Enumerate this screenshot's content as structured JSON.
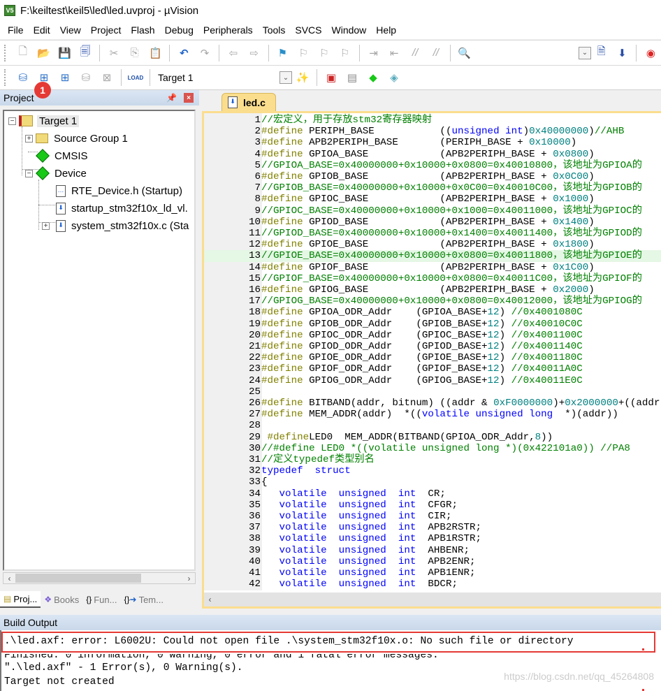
{
  "window": {
    "title": "F:\\keiltest\\keil5\\led\\led.uvproj - µVision",
    "app_icon_text": "V5"
  },
  "menu": [
    "File",
    "Edit",
    "View",
    "Project",
    "Flash",
    "Debug",
    "Peripherals",
    "Tools",
    "SVCS",
    "Window",
    "Help"
  ],
  "toolbar": {
    "target_select": "Target 1",
    "badge": "1",
    "load_label": "LOAD"
  },
  "project_panel": {
    "title": "Project",
    "tree": [
      {
        "label": "Target 1",
        "level": 0,
        "icon": "target-icon",
        "expanded": true
      },
      {
        "label": "Source Group 1",
        "level": 1,
        "icon": "folder-icon",
        "expanded": false
      },
      {
        "label": "CMSIS",
        "level": 1,
        "icon": "component-diamond-icon"
      },
      {
        "label": "Device",
        "level": 1,
        "icon": "component-diamond-icon",
        "expanded": true
      },
      {
        "label": "RTE_Device.h (Startup)",
        "level": 2,
        "icon": "header-file-icon"
      },
      {
        "label": "startup_stm32f10x_ld_vl.",
        "level": 2,
        "icon": "source-file-icon"
      },
      {
        "label": "system_stm32f10x.c (Sta",
        "level": 2,
        "icon": "source-file-icon",
        "expanded": false
      }
    ],
    "tabs": [
      {
        "label": "Proj...",
        "icon": "project-icon",
        "active": true
      },
      {
        "label": "Books",
        "icon": "books-icon",
        "active": false
      },
      {
        "label": "Fun...",
        "icon": "braces-icon",
        "active": false
      },
      {
        "label": "Tem...",
        "icon": "template-icon",
        "active": false
      }
    ]
  },
  "editor": {
    "tab": "led.c",
    "highlighted_line": 13,
    "lines": [
      [
        [
          "cm",
          "//宏定义，用于存放stm32寄存器映射"
        ]
      ],
      [
        [
          "pp",
          "#define"
        ],
        [
          "",
          "PERIPH_BASE           (("
        ],
        [
          "kw",
          "unsigned int"
        ],
        [
          "",
          ")"
        ],
        [
          "nm",
          "0x40000000"
        ],
        [
          "",
          ")"
        ],
        [
          "cm",
          "//AHB"
        ]
      ],
      [
        [
          "pp",
          "#define"
        ],
        [
          "",
          "APB2PERIPH_BASE       (PERIPH_BASE + "
        ],
        [
          "nm",
          "0x10000"
        ],
        [
          "",
          ")"
        ]
      ],
      [
        [
          "pp",
          "#define"
        ],
        [
          "",
          "GPIOA_BASE            (APB2PERIPH_BASE + "
        ],
        [
          "nm",
          "0x0800"
        ],
        [
          "",
          ")"
        ]
      ],
      [
        [
          "cm",
          "//GPIOA_BASE=0x40000000+0x10000+0x0800=0x40010800，该地址为GPIOA的"
        ]
      ],
      [
        [
          "pp",
          "#define"
        ],
        [
          "",
          "GPIOB_BASE            (APB2PERIPH_BASE + "
        ],
        [
          "nm",
          "0x0C00"
        ],
        [
          "",
          ")"
        ]
      ],
      [
        [
          "cm",
          "//GPIOB_BASE=0x40000000+0x10000+0x0C00=0x40010C00，该地址为GPIOB的"
        ]
      ],
      [
        [
          "pp",
          "#define"
        ],
        [
          "",
          "GPIOC_BASE            (APB2PERIPH_BASE + "
        ],
        [
          "nm",
          "0x1000"
        ],
        [
          "",
          ")"
        ]
      ],
      [
        [
          "cm",
          "//GPIOC_BASE=0x40000000+0x10000+0x1000=0x40011000，该地址为GPIOC的"
        ]
      ],
      [
        [
          "pp",
          "#define"
        ],
        [
          "",
          "GPIOD_BASE            (APB2PERIPH_BASE + "
        ],
        [
          "nm",
          "0x1400"
        ],
        [
          "",
          ")"
        ]
      ],
      [
        [
          "cm",
          "//GPIOD_BASE=0x40000000+0x10000+0x1400=0x40011400，该地址为GPIOD的"
        ]
      ],
      [
        [
          "pp",
          "#define"
        ],
        [
          "",
          "GPIOE_BASE            (APB2PERIPH_BASE + "
        ],
        [
          "nm",
          "0x1800"
        ],
        [
          "",
          ")"
        ]
      ],
      [
        [
          "cm",
          "//GPIOE_BASE=0x40000000+0x10000+0x0800=0x40011800，该地址为GPIOE的"
        ]
      ],
      [
        [
          "pp",
          "#define"
        ],
        [
          "",
          "GPIOF_BASE            (APB2PERIPH_BASE + "
        ],
        [
          "nm",
          "0x1C00"
        ],
        [
          "",
          ")"
        ]
      ],
      [
        [
          "cm",
          "//GPIOF_BASE=0x40000000+0x10000+0x0800=0x40011C00，该地址为GPIOF的"
        ]
      ],
      [
        [
          "pp",
          "#define"
        ],
        [
          "",
          "GPIOG_BASE            (APB2PERIPH_BASE + "
        ],
        [
          "nm",
          "0x2000"
        ],
        [
          "",
          ")"
        ]
      ],
      [
        [
          "cm",
          "//GPIOG_BASE=0x40000000+0x10000+0x0800=0x40012000，该地址为GPIOG的"
        ]
      ],
      [
        [
          "pp",
          "#define"
        ],
        [
          "",
          "GPIOA_ODR_Addr    (GPIOA_BASE+"
        ],
        [
          "nm",
          "12"
        ],
        [
          "",
          ") "
        ],
        [
          "cm",
          "//0x4001080C"
        ]
      ],
      [
        [
          "pp",
          "#define"
        ],
        [
          "",
          "GPIOB_ODR_Addr    (GPIOB_BASE+"
        ],
        [
          "nm",
          "12"
        ],
        [
          "",
          ") "
        ],
        [
          "cm",
          "//0x40010C0C"
        ]
      ],
      [
        [
          "pp",
          "#define"
        ],
        [
          "",
          "GPIOC_ODR_Addr    (GPIOC_BASE+"
        ],
        [
          "nm",
          "12"
        ],
        [
          "",
          ") "
        ],
        [
          "cm",
          "//0x4001100C"
        ]
      ],
      [
        [
          "pp",
          "#define"
        ],
        [
          "",
          "GPIOD_ODR_Addr    (GPIOD_BASE+"
        ],
        [
          "nm",
          "12"
        ],
        [
          "",
          ") "
        ],
        [
          "cm",
          "//0x4001140C"
        ]
      ],
      [
        [
          "pp",
          "#define"
        ],
        [
          "",
          "GPIOE_ODR_Addr    (GPIOE_BASE+"
        ],
        [
          "nm",
          "12"
        ],
        [
          "",
          ") "
        ],
        [
          "cm",
          "//0x4001180C"
        ]
      ],
      [
        [
          "pp",
          "#define"
        ],
        [
          "",
          "GPIOF_ODR_Addr    (GPIOF_BASE+"
        ],
        [
          "nm",
          "12"
        ],
        [
          "",
          ") "
        ],
        [
          "cm",
          "//0x40011A0C"
        ]
      ],
      [
        [
          "pp",
          "#define"
        ],
        [
          "",
          "GPIOG_ODR_Addr    (GPIOG_BASE+"
        ],
        [
          "nm",
          "12"
        ],
        [
          "",
          ") "
        ],
        [
          "cm",
          "//0x40011E0C"
        ]
      ],
      [],
      [
        [
          "pp",
          "#define"
        ],
        [
          "",
          "BITBAND(addr, bitnum) ((addr & "
        ],
        [
          "nm",
          "0xF0000000"
        ],
        [
          "",
          ")+"
        ],
        [
          "nm",
          "0x2000000"
        ],
        [
          "",
          "+((addr"
        ]
      ],
      [
        [
          "pp",
          "#define"
        ],
        [
          "",
          "MEM_ADDR(addr)  *(("
        ],
        [
          "kw",
          "volatile unsigned long"
        ],
        [
          "",
          "  *)(addr))"
        ]
      ],
      [],
      [
        [
          "pp",
          " #define"
        ],
        [
          "",
          "LED0  MEM_ADDR(BITBAND(GPIOA_ODR_Addr,"
        ],
        [
          "nm",
          "8"
        ],
        [
          "",
          "))"
        ]
      ],
      [
        [
          "cm",
          "//#define LED0 *((volatile unsigned long *)(0x422101a0)) //PA8"
        ]
      ],
      [
        [
          "cm",
          "//定义typedef类型别名"
        ]
      ],
      [
        [
          "kw",
          "typedef  struct"
        ]
      ],
      [
        [
          "",
          "{"
        ]
      ],
      [
        [
          "",
          "   "
        ],
        [
          "kw",
          "volatile  unsigned  int"
        ],
        [
          "",
          "  CR;"
        ]
      ],
      [
        [
          "",
          "   "
        ],
        [
          "kw",
          "volatile  unsigned  int"
        ],
        [
          "",
          "  CFGR;"
        ]
      ],
      [
        [
          "",
          "   "
        ],
        [
          "kw",
          "volatile  unsigned  int"
        ],
        [
          "",
          "  CIR;"
        ]
      ],
      [
        [
          "",
          "   "
        ],
        [
          "kw",
          "volatile  unsigned  int"
        ],
        [
          "",
          "  APB2RSTR;"
        ]
      ],
      [
        [
          "",
          "   "
        ],
        [
          "kw",
          "volatile  unsigned  int"
        ],
        [
          "",
          "  APB1RSTR;"
        ]
      ],
      [
        [
          "",
          "   "
        ],
        [
          "kw",
          "volatile  unsigned  int"
        ],
        [
          "",
          "  AHBENR;"
        ]
      ],
      [
        [
          "",
          "   "
        ],
        [
          "kw",
          "volatile  unsigned  int"
        ],
        [
          "",
          "  APB2ENR;"
        ]
      ],
      [
        [
          "",
          "   "
        ],
        [
          "kw",
          "volatile  unsigned  int"
        ],
        [
          "",
          "  APB1ENR;"
        ]
      ],
      [
        [
          "",
          "   "
        ],
        [
          "kw",
          "volatile  unsigned  int"
        ],
        [
          "",
          "  BDCR;"
        ]
      ]
    ]
  },
  "build_output": {
    "title": "Build Output",
    "lines": [
      ".\\led.axf: error: L6002U: Could not open file .\\system_stm32f10x.o: No such file or directory",
      "Finished: 0 information, 0 warning, 0 error and 1 fatal error messages.",
      "\".\\led.axf\" - 1 Error(s), 0 Warning(s).",
      "Target not created"
    ],
    "watermark": "https://blog.csdn.net/qq_45264808"
  },
  "colors": {
    "keyword": "#0000ff",
    "preprocessor": "#808000",
    "comment": "#008000",
    "number": "#008080",
    "annotation_red": "#e53935",
    "tab_yellow": "#fbdd8e"
  }
}
